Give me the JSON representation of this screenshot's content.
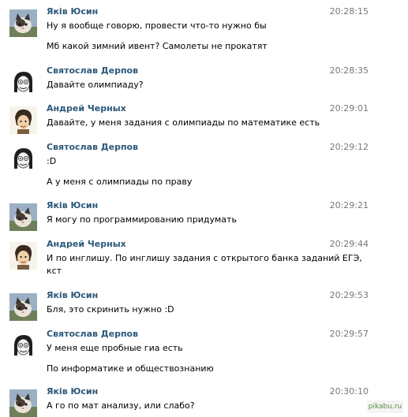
{
  "messages": [
    {
      "author": "Яків Юсин",
      "avatar": "cat-avatar-icon",
      "time": "20:28:15",
      "lines": [
        "Ну я вообще говорю, провести что-то нужно бы",
        "",
        "Мб какой зимний ивент? Самолеты не прокатят"
      ]
    },
    {
      "author": "Святослав Дерпов",
      "avatar": "derp-face-avatar-icon",
      "time": "20:28:35",
      "lines": [
        "Давайте олимпиаду?"
      ]
    },
    {
      "author": "Андрей Черных",
      "avatar": "cartoon-avatar-icon",
      "time": "20:29:01",
      "lines": [
        "Давайте, у меня задания с олимпиады по математике есть"
      ]
    },
    {
      "author": "Святослав Дерпов",
      "avatar": "derp-face-avatar-icon",
      "time": "20:29:12",
      "lines": [
        ":D",
        "",
        "А у меня с олимпиады по праву"
      ]
    },
    {
      "author": "Яків Юсин",
      "avatar": "cat-avatar-icon",
      "time": "20:29:21",
      "lines": [
        "Я могу по программированию придумать"
      ]
    },
    {
      "author": "Андрей Черных",
      "avatar": "cartoon-avatar-icon",
      "time": "20:29:44",
      "lines": [
        "И по инглишу. По инглишу задания с открытого банка заданий ЕГЭ,",
        "кст"
      ]
    },
    {
      "author": "Яків Юсин",
      "avatar": "cat-avatar-icon",
      "time": "20:29:53",
      "lines": [
        "Бля, это скринить нужно :D"
      ]
    },
    {
      "author": "Святослав Дерпов",
      "avatar": "derp-face-avatar-icon",
      "time": "20:29:57",
      "lines": [
        "У меня еще пробные гиа есть",
        "",
        "По информатике и обществознанию"
      ]
    },
    {
      "author": "Яків Юсин",
      "avatar": "cat-avatar-icon",
      "time": "20:30:10",
      "lines": [
        "А го по мат анализу, или слабо?"
      ]
    }
  ],
  "watermark": "pikabu.ru",
  "colors": {
    "author": "#2b587a",
    "time": "#777777",
    "text": "#000000",
    "separator": "#eeeeee"
  }
}
